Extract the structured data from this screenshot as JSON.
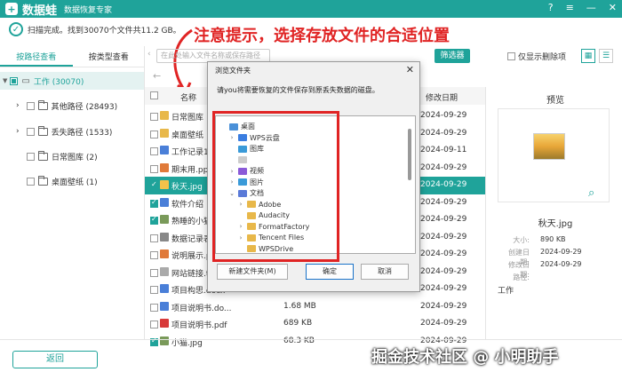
{
  "app": {
    "logo_char": "+",
    "name": "数据蛙",
    "subtitle": "数据恢复专家"
  },
  "status": {
    "text": "扫描完成。找到30070个文件共11.2 GB。"
  },
  "annotation": {
    "text": "注意提示，选择存放文件的合适位置"
  },
  "left_tabs": [
    {
      "label": "按路径查看",
      "active": true
    },
    {
      "label": "按类型查看",
      "active": false
    }
  ],
  "tree": {
    "root": "工作 (30070)",
    "items": [
      {
        "label": "其他路径 (28493)",
        "expandable": true
      },
      {
        "label": "丢失路径 (1533)",
        "expandable": true
      },
      {
        "label": "日常图库 (2)",
        "expandable": false
      },
      {
        "label": "桌面壁纸 (1)",
        "expandable": false
      }
    ]
  },
  "toolbar": {
    "search_placeholder": "在此处输入文件名称或保存路径",
    "filter_label": "筛选器",
    "only_deleted_label": "仅显示删除项"
  },
  "list": {
    "header_name": "名称",
    "header_date": "修改日期",
    "rows": [
      {
        "name": "日常图库",
        "size": "",
        "date": "2024-09-29",
        "checked": false,
        "selected": false,
        "icon": "#e8b84a"
      },
      {
        "name": "桌面壁纸",
        "size": "",
        "date": "2024-09-29",
        "checked": false,
        "selected": false,
        "icon": "#e8b84a"
      },
      {
        "name": "工作记录1",
        "size": "",
        "date": "2024-09-11",
        "checked": false,
        "selected": false,
        "icon": "#4a7fd8"
      },
      {
        "name": "期末用.ppt",
        "size": "",
        "date": "2024-09-29",
        "checked": false,
        "selected": false,
        "icon": "#e07a3a"
      },
      {
        "name": "秋天.jpg",
        "size": "",
        "date": "2024-09-29",
        "checked": true,
        "selected": true,
        "icon": "#f4c24a"
      },
      {
        "name": "软件介绍",
        "size": "",
        "date": "2024-09-29",
        "checked": true,
        "selected": false,
        "icon": "#4a7fd8"
      },
      {
        "name": "熟睡的小猫",
        "size": "",
        "date": "2024-09-29",
        "checked": true,
        "selected": false,
        "icon": "#7a9a5a"
      },
      {
        "name": "数据记录表",
        "size": "",
        "date": "2024-09-29",
        "checked": false,
        "selected": false,
        "icon": "#888888"
      },
      {
        "name": "说明展示.p",
        "size": "",
        "date": "2024-09-29",
        "checked": false,
        "selected": false,
        "icon": "#e07a3a"
      },
      {
        "name": "网站链接.t",
        "size": "",
        "date": "2024-09-29",
        "checked": false,
        "selected": false,
        "icon": "#aaaaaa"
      },
      {
        "name": "项目构思.docx",
        "size": "",
        "date": "2024-09-29",
        "checked": false,
        "selected": false,
        "icon": "#4a7fd8"
      },
      {
        "name": "项目说明书.do...",
        "size": "1.68 MB",
        "date": "2024-09-29",
        "checked": false,
        "selected": false,
        "icon": "#4a7fd8"
      },
      {
        "name": "项目说明书.pdf",
        "size": "689 KB",
        "date": "2024-09-29",
        "checked": false,
        "selected": false,
        "icon": "#d83a3a"
      },
      {
        "name": "小猫.jpg",
        "size": "68.3 KB",
        "date": "2024-09-29",
        "checked": true,
        "selected": false,
        "icon": "#7a9a5a"
      }
    ]
  },
  "preview": {
    "title": "预览",
    "filename": "秋天.jpg",
    "meta": [
      {
        "key": "大小:",
        "value": "890 KB"
      },
      {
        "key": "创建日期:",
        "value": "2024-09-29"
      },
      {
        "key": "修改日期:",
        "value": "2024-09-29"
      },
      {
        "key": "路径:",
        "value": ""
      }
    ],
    "path_value": "工作"
  },
  "dialog": {
    "title": "浏览文件夹",
    "message": "请you将需要恢复的文件保存到原丢失数据的磁盘。",
    "tree": [
      {
        "label": "桌面",
        "indent": 0,
        "chev": "",
        "color": "#4a90d8"
      },
      {
        "label": "WPS云盘",
        "indent": 1,
        "chev": "›",
        "color": "#3a7de0"
      },
      {
        "label": "图库",
        "indent": 1,
        "chev": "",
        "color": "#3a9ad8"
      },
      {
        "label": "",
        "indent": 1,
        "chev": "",
        "color": "#cccccc"
      },
      {
        "label": "视频",
        "indent": 1,
        "chev": "›",
        "color": "#8a5ad8"
      },
      {
        "label": "图片",
        "indent": 1,
        "chev": "›",
        "color": "#3a9ad8"
      },
      {
        "label": "文档",
        "indent": 1,
        "chev": "⌄",
        "color": "#5a7ad8"
      },
      {
        "label": "Adobe",
        "indent": 2,
        "chev": "›",
        "color": "#e8b84a"
      },
      {
        "label": "Audacity",
        "indent": 2,
        "chev": "",
        "color": "#e8b84a"
      },
      {
        "label": "FormatFactory",
        "indent": 2,
        "chev": "›",
        "color": "#e8b84a"
      },
      {
        "label": "Tencent Files",
        "indent": 2,
        "chev": "›",
        "color": "#e8b84a"
      },
      {
        "label": "WPSDrive",
        "indent": 2,
        "chev": "",
        "color": "#e8b84a"
      }
    ],
    "new_folder_label": "新建文件夹(M)",
    "ok_label": "确定",
    "cancel_label": "取消"
  },
  "footer": {
    "back_label": "返回"
  },
  "watermark": "掘金技术社区 @ 小明助手"
}
